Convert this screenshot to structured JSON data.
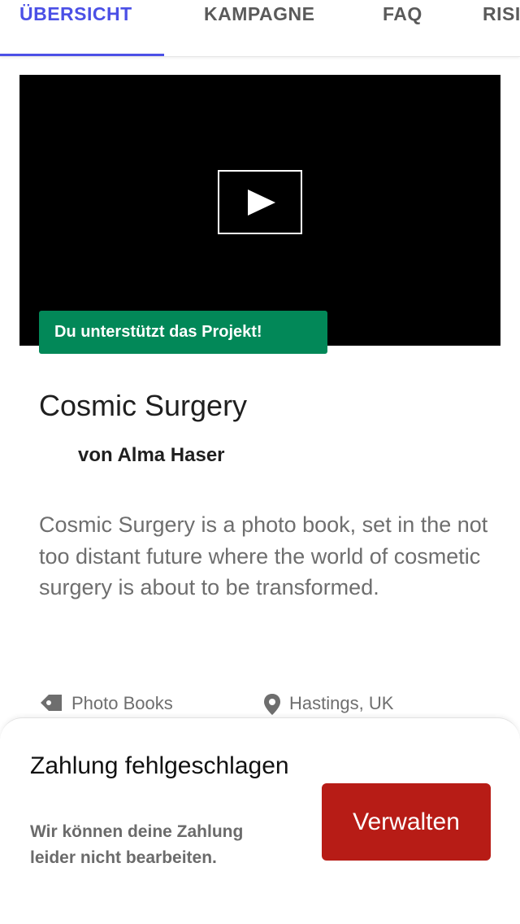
{
  "tabs": [
    {
      "label": "ÜBERSICHT",
      "active": true
    },
    {
      "label": "KAMPAGNE",
      "active": false
    },
    {
      "label": "FAQ",
      "active": false
    },
    {
      "label": "RISIKEN",
      "active": false
    }
  ],
  "video": {
    "play_icon": "play-icon",
    "badge": "Du unterstützt das Projekt!"
  },
  "project": {
    "title": "Cosmic Surgery",
    "byline": "von Alma Haser",
    "description": "Cosmic Surgery is a photo book, set in the not too distant future where the world of cosmetic surgery is about to be transformed.",
    "category": "Photo Books",
    "location": "Hastings, UK"
  },
  "payment_sheet": {
    "title": "Zahlung fehlgeschlagen",
    "message": "Wir können deine Zahlung leider nicht bearbeiten.",
    "button_label": "Verwalten"
  },
  "colors": {
    "accent": "#4b50e6",
    "badge_green": "#028858",
    "danger_red": "#b71c16"
  }
}
